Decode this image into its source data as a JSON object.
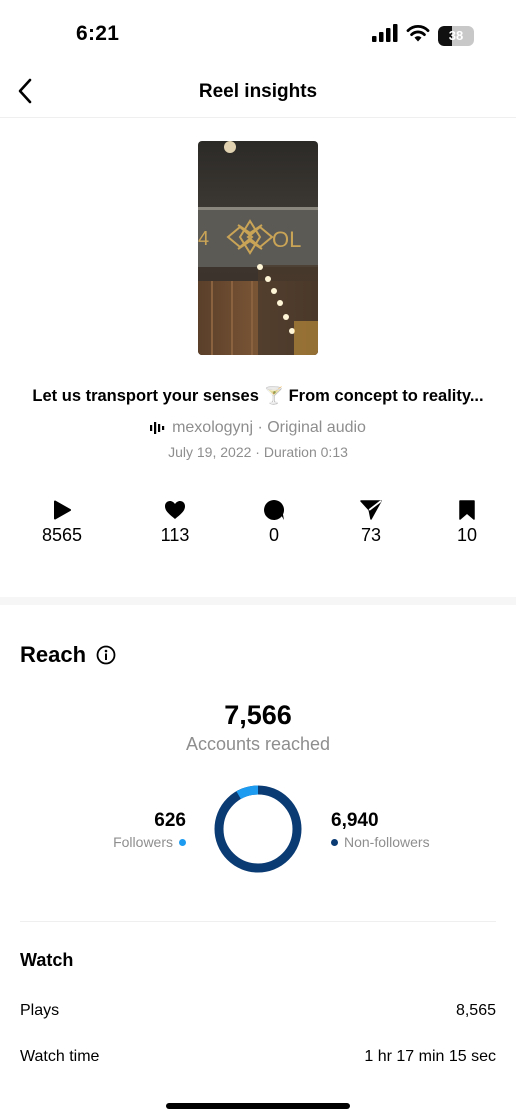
{
  "status": {
    "time": "6:21",
    "battery": "38",
    "battery_fraction": 0.38
  },
  "nav": {
    "title": "Reel insights"
  },
  "reel": {
    "caption": "Let us transport your senses 🍸 From concept to reality...",
    "audio": "mexologynj · Original audio",
    "meta": "July 19, 2022 · Duration 0:13"
  },
  "stats": [
    {
      "icon": "play-icon",
      "value": "8565"
    },
    {
      "icon": "heart-icon",
      "value": "113"
    },
    {
      "icon": "comment-icon",
      "value": "0"
    },
    {
      "icon": "share-icon",
      "value": "73"
    },
    {
      "icon": "bookmark-icon",
      "value": "10"
    }
  ],
  "reach": {
    "title": "Reach",
    "total": "7,566",
    "total_label": "Accounts reached",
    "followers": {
      "value": "626",
      "label": "Followers",
      "count": 626,
      "color": "#1d9bf0"
    },
    "non_followers": {
      "value": "6,940",
      "label": "Non-followers",
      "count": 6940,
      "color": "#0b3b73"
    }
  },
  "watch": {
    "title": "Watch",
    "plays_label": "Plays",
    "plays_value": "8,565",
    "watch_time_label": "Watch time",
    "watch_time_value": "1 hr 17 min 15 sec"
  }
}
